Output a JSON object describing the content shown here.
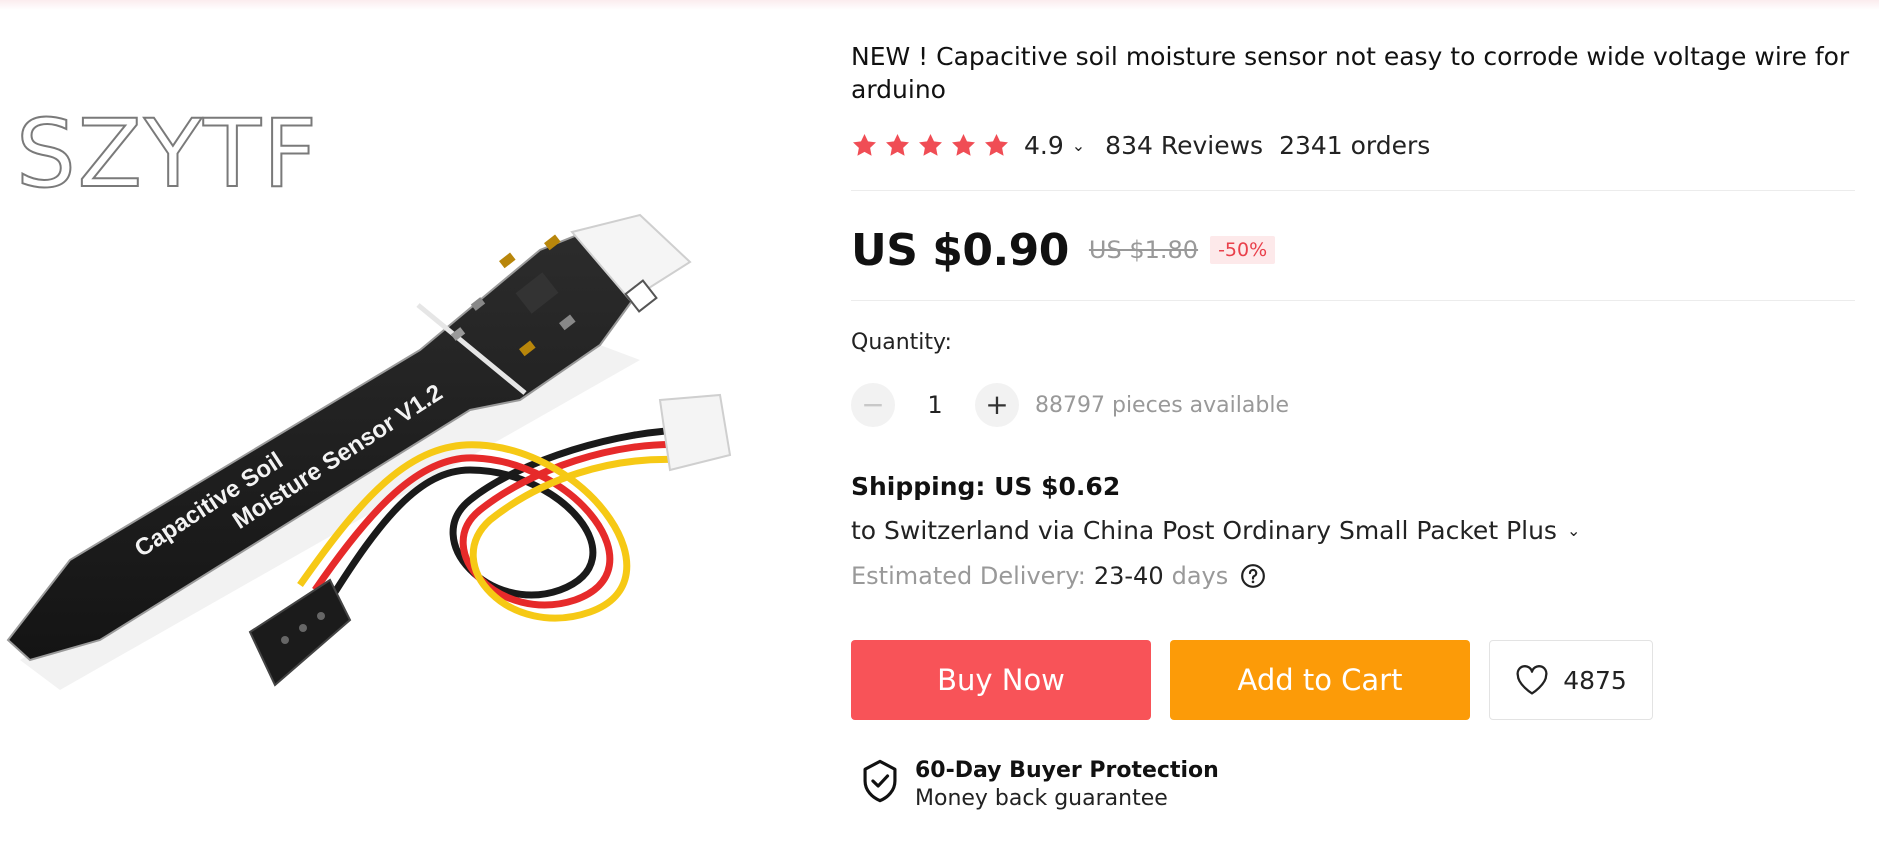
{
  "product_image": {
    "brand_watermark": "SZYTF",
    "board_text_line1": "Capacitive Soil",
    "board_text_line2": "Moisture Sensor V1.2"
  },
  "product": {
    "title": "NEW ! Capacitive soil moisture sensor not easy to corrode wide voltage wire for arduino",
    "rating_value": "4.9",
    "rating_stars": 5,
    "reviews": "834 Reviews",
    "orders": "2341 orders"
  },
  "price": {
    "current": "US $0.90",
    "original": "US $1.80",
    "discount": "-50%"
  },
  "quantity": {
    "label": "Quantity:",
    "minus": "−",
    "value": "1",
    "plus": "+",
    "available": "88797 pieces available"
  },
  "shipping": {
    "title": "Shipping: US $0.62",
    "route": "to Switzerland via China Post Ordinary Small Packet Plus",
    "eta_label": "Estimated Delivery:",
    "eta_days": "23-40",
    "eta_unit": "days"
  },
  "actions": {
    "buy_now": "Buy Now",
    "add_to_cart": "Add to Cart",
    "wishlist_count": "4875"
  },
  "protection": {
    "title": "60-Day Buyer Protection",
    "subtitle": "Money back guarantee"
  },
  "colors": {
    "buy_now": "#f85358",
    "add_to_cart": "#fc9b08",
    "star": "#f04d55",
    "discount": "#e9404b"
  },
  "icons": [
    "star-icon",
    "chevron-down-icon",
    "minus-icon",
    "plus-icon",
    "help-circle-icon",
    "heart-icon",
    "shield-check-icon"
  ]
}
